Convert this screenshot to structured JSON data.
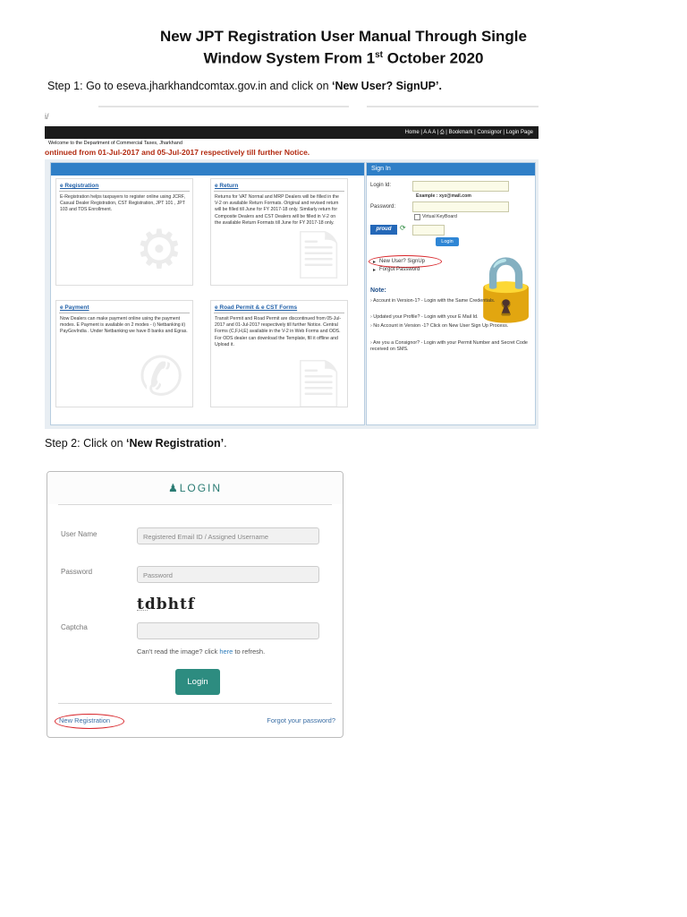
{
  "document": {
    "title_line1": "New JPT Registration User Manual Through Single",
    "title_line2_prefix": "Window System From 1",
    "title_line2_sup": "st",
    "title_line2_suffix": " October 2020",
    "step1_prefix": "Step 1: Go to eseva.jharkhandcomtax.gov.in and click on ",
    "step1_bold": "‘New User? SignUP’.",
    "step2_prefix": "Step 2: Click on ",
    "step2_bold": "‘New Registration’",
    "step2_suffix": "."
  },
  "portal": {
    "address_fragment": "i/",
    "topnav": "Home | A A A | ⎙ | Bookmark | Consignor | Login Page",
    "welcome": "Welcome to the Department of Commercial Taxes, Jharkhand",
    "ticker": "ontinued from 01-Jul-2017 and 05-Jul-2017 respectively till further Notice.",
    "cards": [
      {
        "title": "e Registration",
        "text": "E-Registration helps taxpayers to register online using JCRF, Casual Dealer Registration, CST Registration, JPT 101 , JPT 103 and TDS Enrollment."
      },
      {
        "title": "e Return",
        "text": "Returns for VAT Normal and MRP Dealers will be filled in the V-2 on available Return Formats. Original and revised return will be filled till June for FY 2017-18 only. Similarly return for Composite Dealers and CST Dealers will be filled in V-2 on the available Return Formats till June for FY 2017-18 only."
      },
      {
        "title": "e Payment",
        "text": "Now Dealers can make payment online using the payment modes. E Payment is available on 2 modes - i) Netbanking ii) PayGovIndia . Under Netbanking we have 8 banks and Egras."
      },
      {
        "title": "e Road Permit & e CST Forms",
        "text": "Transit Permit and Road Permit are discontinued from 05-Jul-2017 and 01-Jul-2017 respectively till further Notice. Central Forms (C,F,H,E) available in the V-2 in Web Forms and ODS. For ODS dealer can download the Template, fill it offline and Upload it."
      }
    ],
    "signin": {
      "header": "Sign In",
      "login_id_label": "Login Id:",
      "example": "Example : xyz@mail.com",
      "password_label": "Password:",
      "virtual_keyboard": "Virtual KeyBoard",
      "captcha_text": "proud",
      "login_button": "Login",
      "new_user_link": "New User? SignUp",
      "forgot_link": "Forgot Password",
      "note_title": "Note:",
      "notes": [
        "Account in Version-1? - Login with the Same Credentials.",
        "Updated your Profile? - Login with your E Mail Id.",
        "No Account in Version -1? Click on New User Sign Up Process.",
        "Are you a Consignor? - Login with your Permit Number and Secret Code received on SMS."
      ]
    }
  },
  "login_panel": {
    "header": "LOGIN",
    "header_icon": "user-icon",
    "username_label": "User Name",
    "username_placeholder": "Registered Email ID / Assigned Username",
    "password_label": "Password",
    "password_placeholder": "Password",
    "captcha_image_text": "tdbhtf",
    "captcha_label": "Captcha",
    "cant_read_prefix": "Can't read the image? click ",
    "cant_read_link": "here",
    "cant_read_suffix": " to refresh.",
    "login_button": "Login",
    "new_registration": "New Registration",
    "forgot_password": "Forgot your password?"
  },
  "colors": {
    "portal_blue": "#2f7fc7",
    "ticker_red": "#b22a10",
    "login_teal": "#2d8c80",
    "highlight_ring": "#d8252a"
  }
}
